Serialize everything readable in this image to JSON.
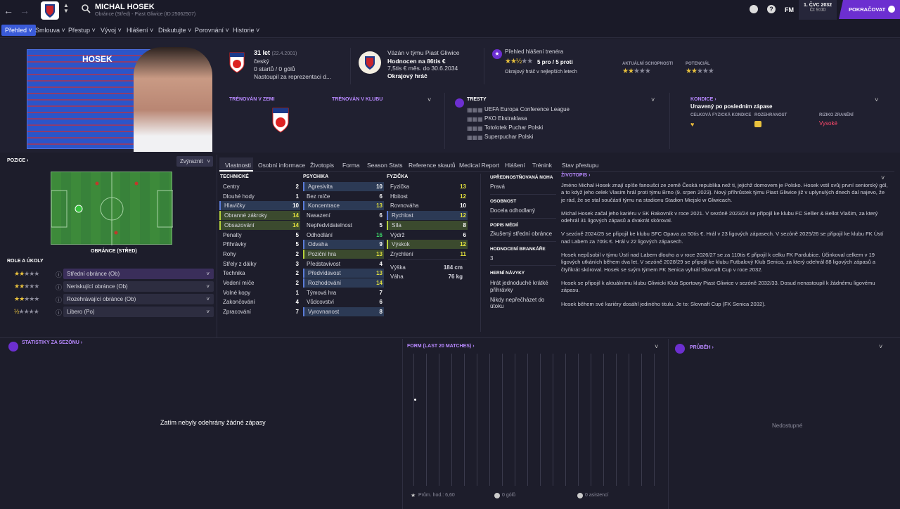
{
  "club_badge": "Piast Gliwice",
  "player": {
    "name": "MICHAL HOSEK",
    "subtitle": "Obránce (Střed) - Piast Gliwice (ID:25062507)",
    "kit_name": "HOSEK"
  },
  "topright": {
    "date": "1. ČVC 2032",
    "time": "Čt 9:00",
    "continue": "POKRAČOVAT",
    "fm": "FM",
    "help": "?"
  },
  "nav": [
    "Přehled",
    "Smlouva",
    "Přestup",
    "Vývoj",
    "Hlášení",
    "Diskutujte",
    "Porovnání",
    "Historie"
  ],
  "bio": {
    "age": "31 let",
    "dob": "(22.4.2001)",
    "nationality": "český",
    "caps": "0 startů / 0 gólů",
    "national_status": "Nastoupil za reprezentaci d..."
  },
  "contract": {
    "line1": "Vázán v týmu Piast Gliwice",
    "line2": "Hodnocen na 86tis €",
    "line3": "7,5tis € měs. do 30.6.2034",
    "line4": "Okrajový hráč"
  },
  "scout": {
    "title": "Přehled hlášení trenéra",
    "pros": "5 pro / 5 proti",
    "desc": "Okrajový hráč v nejlepších letech",
    "current_label": "AKTUÁLNÍ SCHOPNOSTI",
    "potential_label": "POTENCIÁL",
    "current_stars": 2.5,
    "potential_stars": 2.5
  },
  "trained": {
    "nation": "TRÉNOVÁN V ZEMI",
    "club": "TRÉNOVÁN V KLUBU"
  },
  "bans": {
    "title": "TRESTY",
    "items": [
      "UEFA Europa Conference League",
      "PKO Ekstraklasa",
      "Totolotek Puchar Polski",
      "Superpuchar Polski"
    ]
  },
  "condition": {
    "title": "KONDICE",
    "status": "Unavený po posledním zápase",
    "fitness_label": "CELKOVÁ FYZICKÁ KONDICE",
    "sharpness_label": "ROZEHRANOST",
    "injury_label": "RIZIKO ZRANĚNÍ",
    "injury_value": "Vysoké"
  },
  "position": {
    "title": "POZICE",
    "highlight": "Zvýraznit",
    "label": "OBRÁNCE (STŘED)"
  },
  "roles": {
    "title": "ROLE A ÚKOLY",
    "items": [
      {
        "name": "Střední obránce (Ob)",
        "stars": 2
      },
      {
        "name": "Neriskující obránce (Ob)",
        "stars": 2
      },
      {
        "name": "Rozehrávající obránce (Ob)",
        "stars": 2
      },
      {
        "name": "Libero (Po)",
        "stars": 0.5
      }
    ]
  },
  "tabs": [
    "Vlastnosti",
    "Osobní informace",
    "Životopis",
    "Forma",
    "Season Stats",
    "Reference skautů",
    "Medical Report",
    "Hlášení",
    "Trénink",
    "Stav přestupu"
  ],
  "attributes": {
    "technical_title": "TECHNICKÉ",
    "mental_title": "PSYCHIKA",
    "physical_title": "FYZIČKA",
    "technical": [
      {
        "n": "Centry",
        "v": "2",
        "h": ""
      },
      {
        "n": "Dlouhé hody",
        "v": "1",
        "h": ""
      },
      {
        "n": "Hlavičky",
        "v": "10",
        "h": "b"
      },
      {
        "n": "Obranné zákroky",
        "v": "14",
        "h": "g"
      },
      {
        "n": "Obsazování",
        "v": "14",
        "h": "g"
      },
      {
        "n": "Penalty",
        "v": "5",
        "h": ""
      },
      {
        "n": "Přihrávky",
        "v": "5",
        "h": ""
      },
      {
        "n": "Rohy",
        "v": "2",
        "h": ""
      },
      {
        "n": "Střely z dálky",
        "v": "3",
        "h": ""
      },
      {
        "n": "Technika",
        "v": "2",
        "h": ""
      },
      {
        "n": "Vedení míče",
        "v": "2",
        "h": ""
      },
      {
        "n": "Volné kopy",
        "v": "1",
        "h": ""
      },
      {
        "n": "Zakončování",
        "v": "4",
        "h": ""
      },
      {
        "n": "Zpracování",
        "v": "7",
        "h": ""
      }
    ],
    "mental": [
      {
        "n": "Agresivita",
        "v": "10",
        "h": "b"
      },
      {
        "n": "Bez míče",
        "v": "6",
        "h": ""
      },
      {
        "n": "Koncentrace",
        "v": "13",
        "h": "b"
      },
      {
        "n": "Nasazení",
        "v": "6",
        "h": ""
      },
      {
        "n": "Nepředvídatelnost",
        "v": "5",
        "h": ""
      },
      {
        "n": "Odhodlání",
        "v": "16",
        "h": ""
      },
      {
        "n": "Odvaha",
        "v": "9",
        "h": "b"
      },
      {
        "n": "Poziční hra",
        "v": "13",
        "h": "g"
      },
      {
        "n": "Představivost",
        "v": "4",
        "h": ""
      },
      {
        "n": "Předvídavost",
        "v": "13",
        "h": "b"
      },
      {
        "n": "Rozhodování",
        "v": "14",
        "h": "b"
      },
      {
        "n": "Týmová hra",
        "v": "7",
        "h": ""
      },
      {
        "n": "Vůdcovství",
        "v": "6",
        "h": ""
      },
      {
        "n": "Vyrovnanost",
        "v": "8",
        "h": "b"
      }
    ],
    "physical": [
      {
        "n": "Fyzička",
        "v": "13",
        "h": ""
      },
      {
        "n": "Hbitost",
        "v": "12",
        "h": ""
      },
      {
        "n": "Rovnováha",
        "v": "10",
        "h": ""
      },
      {
        "n": "Rychlost",
        "v": "12",
        "h": "b"
      },
      {
        "n": "Síla",
        "v": "8",
        "h": "g"
      },
      {
        "n": "Výdrž",
        "v": "6",
        "h": ""
      },
      {
        "n": "Výskok",
        "v": "12",
        "h": "g"
      },
      {
        "n": "Zrychlení",
        "v": "11",
        "h": ""
      }
    ],
    "height_label": "Výška",
    "height": "184 cm",
    "weight_label": "Váha",
    "weight": "76 kg"
  },
  "info": {
    "foot_label": "UPŘEDNOSTŇOVANÁ NOHA",
    "foot": "Pravá",
    "personality_label": "OSOBNOST",
    "personality": "Docela odhodlaný",
    "media_label": "POPIS MÉDIÍ",
    "media": "Zkušený střední obránce",
    "caps_label": "HODNOCENÍ BRANKÁŘE",
    "caps": "3",
    "habits_label": "HERNÍ NÁVYKY",
    "habits": [
      "Hrát jednoduché krátké přihrávky",
      "Nikdy nepřečházet do útoku"
    ]
  },
  "biography": {
    "title": "ŽIVOTOPIS",
    "paragraphs": [
      "Jméno Michal Hosek znají spíše fanoušci ze země Česká republika než ti, jejichž domovem je Polsko. Hosek vstil svůj první seniorský gól, a to když jeho celek Vlasim hrál proti týmu Brno (9. srpen 2023). Nový příhrůstek týmu Piast Gliwice již v uplynulých dnech dal najevo, že je rád, že se stal součástí týmu na stadionu Stadion Miejski w Gliwicach.",
      "Michal Hosek začal jeho kariéru v SK Rakovník v roce 2021. V sezóně 2023/24 se připojil ke klubu FC Sellier & Bellot Vlašim, za který odehrál 31 ligových zápasů a dvakrát skóroval.",
      "V sezóně 2024/25 se připojil ke klubu SFC Opava za 50tis €. Hrál v 23 ligových zápasech. V sezóně 2025/26 se připojil ke klubu FK Ústí nad Labem za 70tis €. Hrál v 22 ligových zápasech.",
      "Hosek nepůsobil v týmu Ústí nad Labem dlouho a v roce 2026/27 se za 110tis € připojil k celku FK Pardubice. Účinkoval celkem v 19 ligových utkáních během dva let. V sezóně 2028/29 se připojil ke klubu Futbalový Klub Senica, za který odehrál 88 ligových zápasů a čtyřikrát skóroval. Hosek se svým týmem FK Senica vyhrál Slovnaft Cup v roce 2032.",
      "Hosek se připojil k aktuálnímu klubu Gliwicki Klub Sportowy Piast Gliwice v sezóně 2032/33. Dosud nenastoupil k žádnému ligovému zápasu.",
      "Hosek během své kariéry dosáhl jediného titulu. Je to: Slovnaft Cup (FK Senica 2032)."
    ]
  },
  "season": {
    "title": "STATISTIKY ZA SEZÓNU",
    "empty": "Zatím nebyly odehrány žádné zápasy"
  },
  "form": {
    "title": "FORM (LAST 20 MATCHES)",
    "avg": "Prům. hod.: 6,60",
    "goals": "0 gólů",
    "assists": "0 asistencí"
  },
  "progress": {
    "title": "PRŮBĚH",
    "value": "Nedostupné"
  }
}
